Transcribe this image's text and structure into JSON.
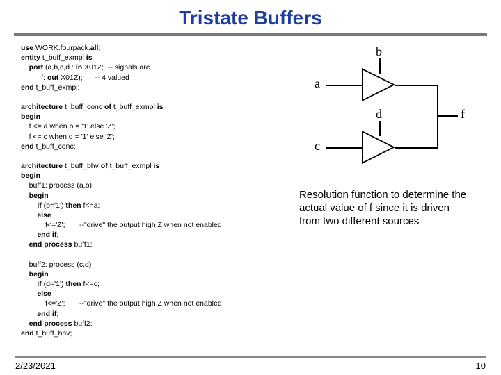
{
  "title": "Tristate Buffers",
  "code": {
    "l1a": "use",
    "l1b": " WORK.fourpack.",
    "l1c": "all",
    "l1d": ";",
    "l2a": "entity",
    "l2b": " t_buff_exmpl ",
    "l2c": "is",
    "l3a": "    port",
    "l3b": " (a,b,c,d : ",
    "l3c": "in",
    "l3d": " X01Z;  -- signals are",
    "l4a": "          f: ",
    "l4b": "out",
    "l4c": " X01Z);      -- 4 valued",
    "l5a": "end",
    "l5b": " t_buff_exmpl;",
    "blank1": " ",
    "l6a": "architecture",
    "l6b": " t_buff_conc ",
    "l6c": "of",
    "l6d": " t_buff_exmpl ",
    "l6e": "is",
    "l7a": "begin",
    "l8": "    f <= a when b = '1' else 'Z';",
    "l9": "    f <= c when d = '1' else 'Z';",
    "l10a": "end",
    "l10b": " t_buff_conc;",
    "blank2": " ",
    "l11a": "architecture",
    "l11b": " t_buff_bhv ",
    "l11c": "of",
    "l11d": " t_buff_exmpl ",
    "l11e": "is",
    "l12a": "begin",
    "l13": "    buff1: process (a,b)",
    "l14a": "    begin",
    "l15a": "        if",
    "l15b": " (b='1') ",
    "l15c": "then",
    "l15d": " f<=a;",
    "l16a": "        else",
    "l17": "            f<='Z';       --\"drive\" the output high Z when not enabled",
    "l18a": "        end if",
    "l18b": ";",
    "l19a": "    end process",
    "l19b": " buff1;",
    "blank3": " ",
    "l20": "    buff2: process (c,d)",
    "l21a": "    begin",
    "l22a": "        if",
    "l22b": " (d='1') ",
    "l22c": "then",
    "l22d": " f<=c;",
    "l23a": "        else",
    "l24": "            f<='Z';       --\"drive\" the output high Z when not enabled",
    "l25a": "        end if",
    "l25b": ";",
    "l26a": "    end process",
    "l26b": " buff2;",
    "l27a": "end",
    "l27b": " t_buff_bhv;"
  },
  "diagram": {
    "a": "a",
    "b": "b",
    "c": "c",
    "d": "d",
    "f": "f"
  },
  "explain": "Resolution function to determine the actual value of f since it is driven from two different sources",
  "footer": {
    "date": "2/23/2021",
    "page": "10"
  }
}
